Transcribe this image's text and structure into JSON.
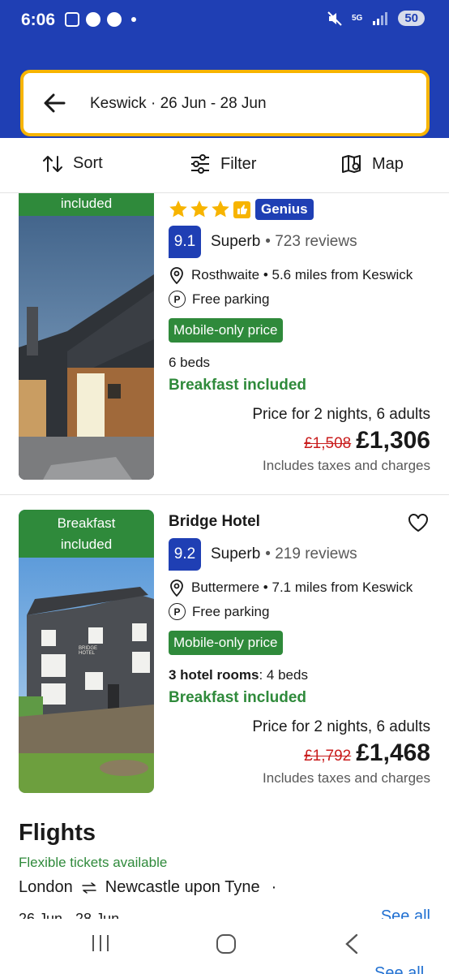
{
  "status": {
    "time": "6:06",
    "network": "5G",
    "battery": "50"
  },
  "search": {
    "query": "Keswick · 26 Jun - 28 Jun"
  },
  "toolbar": {
    "sort_label": "Sort",
    "filter_label": "Filter",
    "map_label": "Map"
  },
  "hotels": [
    {
      "name": "",
      "badge": "included",
      "star_count": 3,
      "genius_label": "Genius",
      "score": "9.1",
      "score_word": "Superb",
      "reviews": "• 723 reviews",
      "location": "Rosthwaite • 5.6 miles from Keswick",
      "parking": "Free parking",
      "mobile_price": "Mobile-only price",
      "beds_bold": "",
      "beds": "6 beds",
      "breakfast": "Breakfast included",
      "price_for": "Price for 2 nights, 6 adults",
      "old_price": "£1,508",
      "new_price": "£1,306",
      "taxes": "Includes taxes and charges"
    },
    {
      "name": "Bridge Hotel",
      "badge_line1": "Breakfast",
      "badge_line2": "included",
      "score": "9.2",
      "score_word": "Superb",
      "reviews": "• 219 reviews",
      "location": "Buttermere • 7.1 miles from Keswick",
      "parking": "Free parking",
      "mobile_price": "Mobile-only price",
      "beds_bold": "3 hotel rooms",
      "beds": ": 4 beds",
      "breakfast": "Breakfast included",
      "price_for": "Price for 2 nights, 6 adults",
      "old_price": "£1,792",
      "new_price": "£1,468",
      "taxes": "Includes taxes and charges",
      "sign_text": "BRIDGE HOTEL"
    }
  ],
  "flights": {
    "title": "Flights",
    "subtitle": "Flexible tickets available",
    "from": "London",
    "to": "Newcastle upon Tyne",
    "sep": "·",
    "dates": "26 Jun - 28 Jun",
    "see_all": "See all"
  },
  "colors": {
    "brand_blue": "#1f3fb4",
    "accent_yellow": "#f7b400",
    "green": "#2f8a3b",
    "strike_red": "#c91d1d",
    "link_blue": "#1f6fd1"
  }
}
